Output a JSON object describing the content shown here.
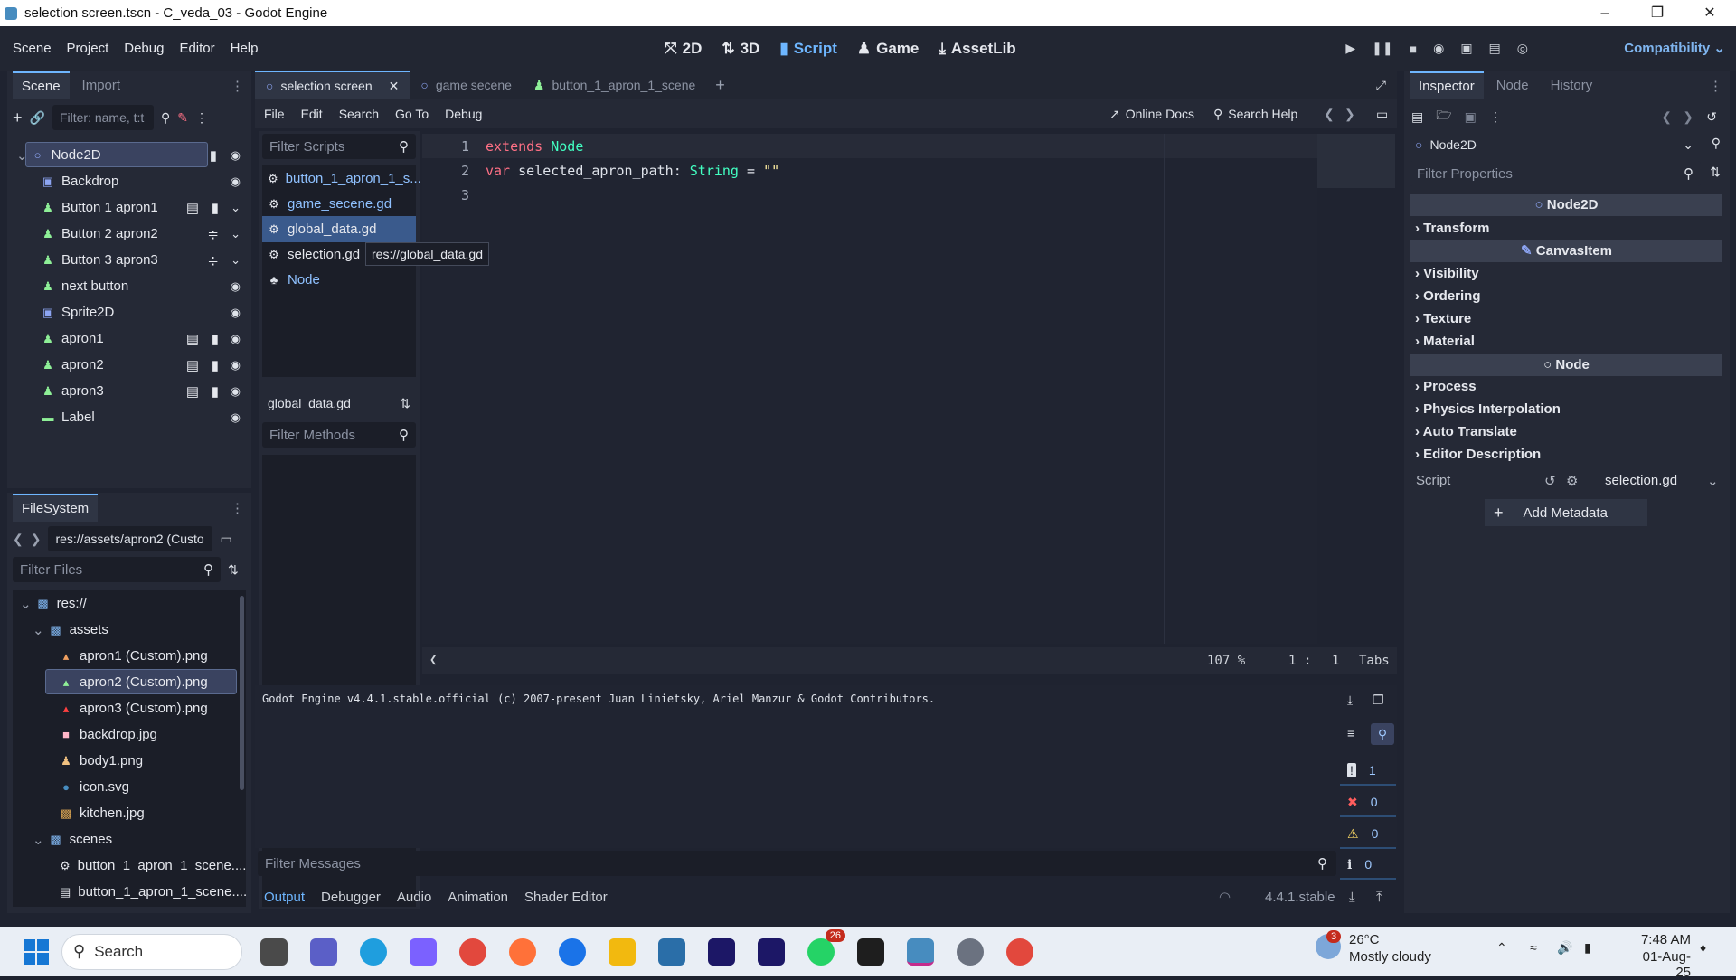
{
  "window": {
    "title": "selection screen.tscn - C_veda_03 - Godot Engine"
  },
  "menu": [
    "Scene",
    "Project",
    "Debug",
    "Editor",
    "Help"
  ],
  "workspaces": [
    {
      "label": "2D",
      "icon": "2d-icon"
    },
    {
      "label": "3D",
      "icon": "3d-icon"
    },
    {
      "label": "Script",
      "icon": "script-icon"
    },
    {
      "label": "Game",
      "icon": "game-icon"
    },
    {
      "label": "AssetLib",
      "icon": "assetlib-icon"
    }
  ],
  "renderer": "Compatibility",
  "scene_dock": {
    "tabs": [
      "Scene",
      "Import"
    ],
    "filter_placeholder": "Filter: name, t:t",
    "nodes": [
      {
        "name": "Node2D",
        "color": "#8da5f3"
      },
      {
        "name": "Backdrop",
        "color": "#8da5f3"
      },
      {
        "name": "Button 1 apron1",
        "color": "#8eef97"
      },
      {
        "name": "Button 2 apron2",
        "color": "#8eef97"
      },
      {
        "name": "Button 3 apron3",
        "color": "#8eef97"
      },
      {
        "name": "next button",
        "color": "#8eef97"
      },
      {
        "name": "Sprite2D",
        "color": "#8da5f3"
      },
      {
        "name": "apron1",
        "color": "#8eef97"
      },
      {
        "name": "apron2",
        "color": "#8eef97"
      },
      {
        "name": "apron3",
        "color": "#8eef97"
      },
      {
        "name": "Label",
        "color": "#8eef97"
      }
    ]
  },
  "filesystem": {
    "tab": "FileSystem",
    "path": "res://assets/apron2 (Custo",
    "filter_placeholder": "Filter Files",
    "items": [
      {
        "label": "res://",
        "indent": 0
      },
      {
        "label": "assets",
        "indent": 1
      },
      {
        "label": "apron1 (Custom).png",
        "indent": 2
      },
      {
        "label": "apron2 (Custom).png",
        "indent": 2
      },
      {
        "label": "apron3 (Custom).png",
        "indent": 2
      },
      {
        "label": "backdrop.jpg",
        "indent": 2
      },
      {
        "label": "body1.png",
        "indent": 2
      },
      {
        "label": "icon.svg",
        "indent": 2
      },
      {
        "label": "kitchen.jpg",
        "indent": 2
      },
      {
        "label": "scenes",
        "indent": 1
      },
      {
        "label": "button_1_apron_1_scene....",
        "indent": 2
      },
      {
        "label": "button_1_apron_1_scene....",
        "indent": 2
      }
    ]
  },
  "editor_tabs": [
    "selection screen",
    "game secene",
    "button_1_apron_1_scene"
  ],
  "script_menu": [
    "File",
    "Edit",
    "Search",
    "Go To",
    "Debug"
  ],
  "script_toolbar": {
    "online_docs": "Online Docs",
    "search_help": "Search Help"
  },
  "scripts": {
    "filter_placeholder": "Filter Scripts",
    "list": [
      "button_1_apron_1_s...",
      "game_secene.gd",
      "global_data.gd",
      "selection.gd",
      "Node"
    ],
    "tooltip": "res://global_data.gd",
    "current": "global_data.gd",
    "methods_placeholder": "Filter Methods"
  },
  "code": [
    {
      "n": "1",
      "parts": [
        {
          "t": "extends ",
          "c": "kw"
        },
        {
          "t": "Node",
          "c": "ty"
        }
      ]
    },
    {
      "n": "2",
      "parts": [
        {
          "t": "var ",
          "c": "kw"
        },
        {
          "t": "selected_apron_path: ",
          "c": ""
        },
        {
          "t": "String",
          "c": "ty"
        },
        {
          "t": " = ",
          "c": ""
        },
        {
          "t": "\"\"",
          "c": "str"
        }
      ]
    },
    {
      "n": "3",
      "parts": []
    }
  ],
  "status": {
    "zoom": "107 %",
    "line": "1",
    "col": "1",
    "indent": "Tabs"
  },
  "output": {
    "text": "Godot Engine v4.4.1.stable.official (c) 2007-present Juan Linietsky, Ariel Manzur & Godot Contributors.",
    "filter_placeholder": "Filter Messages",
    "counts": [
      "1",
      "0",
      "0",
      "0"
    ]
  },
  "bottom_tabs": [
    "Output",
    "Debugger",
    "Audio",
    "Animation",
    "Shader Editor"
  ],
  "version": "4.4.1.stable",
  "inspector": {
    "tabs": [
      "Inspector",
      "Node",
      "History"
    ],
    "object": "Node2D",
    "filter_placeholder": "Filter Properties",
    "sections": [
      "Node2D",
      "CanvasItem",
      "Node"
    ],
    "categories": [
      "Transform",
      "Visibility",
      "Ordering",
      "Texture",
      "Material",
      "Process",
      "Physics Interpolation",
      "Auto Translate",
      "Editor Description"
    ],
    "script_label": "Script",
    "script_value": "selection.gd",
    "add_metadata": "Add Metadata"
  },
  "taskbar": {
    "search": "Search",
    "weather_temp": "26°C",
    "weather_desc": "Mostly cloudy",
    "time": "7:48 AM",
    "date": "01-Aug-25",
    "badge_weather": "3",
    "badge_whatsapp": "26"
  }
}
